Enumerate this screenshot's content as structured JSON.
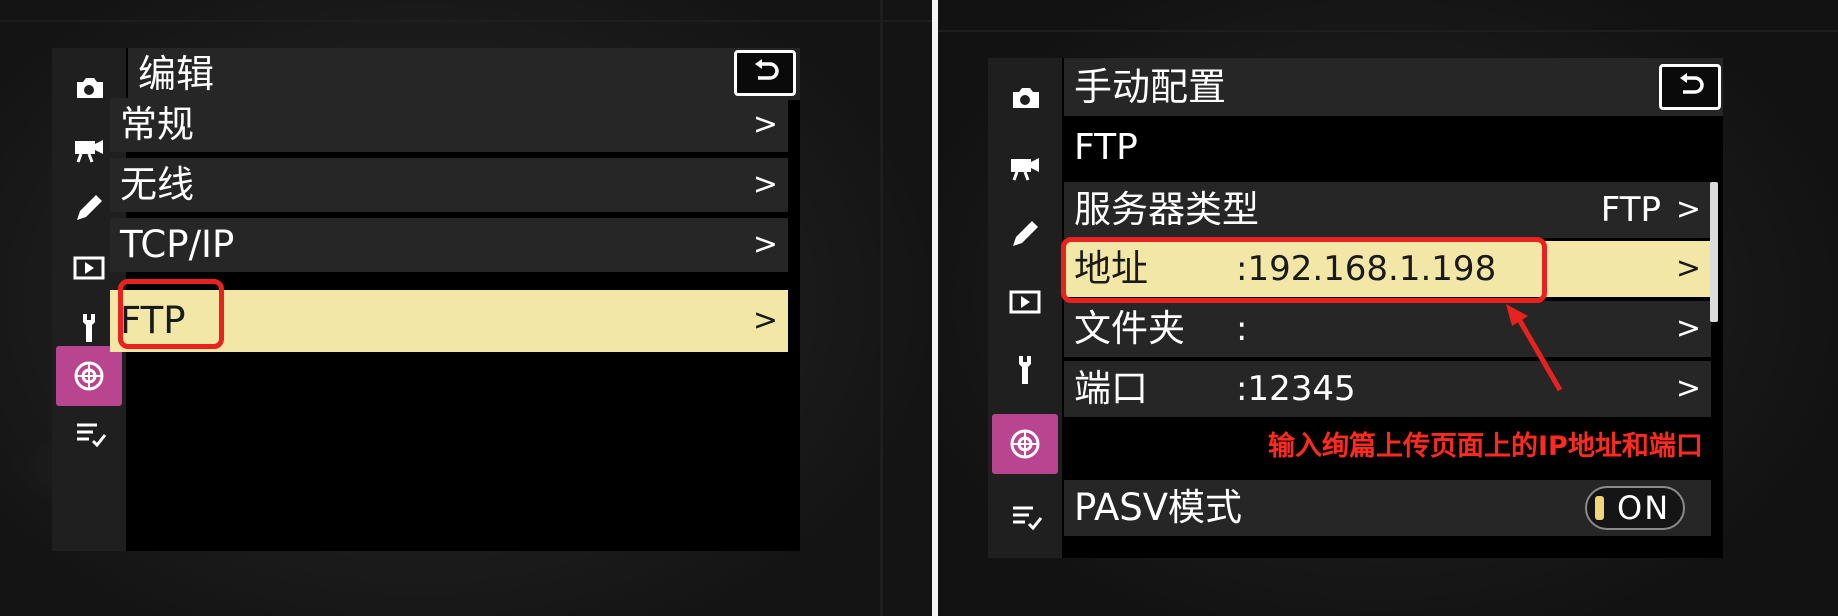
{
  "left_screen": {
    "title": "编辑",
    "items": [
      {
        "label": "常规"
      },
      {
        "label": "无线"
      },
      {
        "label": "TCP/IP"
      },
      {
        "label": "FTP",
        "selected": true
      }
    ],
    "chevron": ">"
  },
  "right_screen": {
    "title": "手动配置",
    "subtitle": "FTP",
    "items": [
      {
        "label": "服务器类型",
        "value": "FTP"
      },
      {
        "label": "地址",
        "value": ":192.168.1.198",
        "selected": true
      },
      {
        "label": "文件夹",
        "value": ":"
      },
      {
        "label": "端口",
        "value": ":12345"
      }
    ],
    "pasv": {
      "label": "PASV模式",
      "toggle": "ON"
    },
    "chevron": ">"
  },
  "annotation": {
    "text": "输入绚篇上传页面上的IP地址和端口",
    "color": "#ff2a1f"
  },
  "sidebar_icons": [
    "camera-icon",
    "movie-camera-icon",
    "pencil-icon",
    "playback-icon",
    "wrench-icon",
    "network-icon",
    "my-menu-icon"
  ],
  "colors": {
    "selected_row": "#f3e7a7",
    "active_tab": "#b9448f",
    "highlight_box": "#e8231f"
  }
}
